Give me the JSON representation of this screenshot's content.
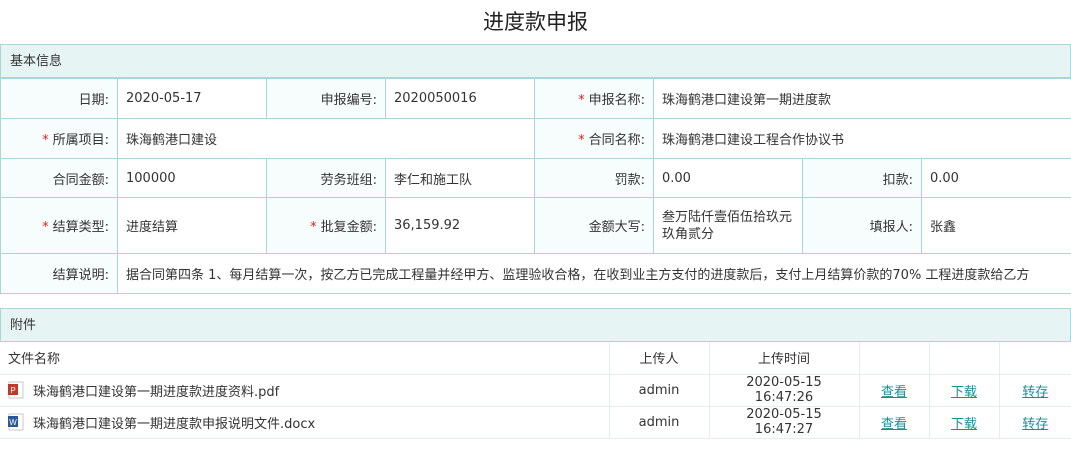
{
  "page": {
    "title": "进度款申报"
  },
  "basic": {
    "header": "基本信息",
    "rows": [
      [
        {
          "label": "日期:",
          "value": "2020-05-17",
          "required": false
        },
        {
          "label": "申报编号:",
          "value": "2020050016",
          "required": false
        },
        {
          "label": "申报名称:",
          "value": "珠海鹤港口建设第一期进度款",
          "required": true
        }
      ],
      [
        {
          "label": "所属项目:",
          "value": "珠海鹤港口建设",
          "required": true
        },
        {
          "label": "合同名称:",
          "value": "珠海鹤港口建设工程合作协议书",
          "required": true
        }
      ],
      [
        {
          "label": "合同金额:",
          "value": "100000",
          "required": false
        },
        {
          "label": "劳务班组:",
          "value": "李仁和施工队",
          "required": false
        },
        {
          "label": "罚款:",
          "value": "0.00",
          "required": false
        },
        {
          "label": "扣款:",
          "value": "0.00",
          "required": false
        }
      ],
      [
        {
          "label": "结算类型:",
          "value": "进度结算",
          "required": true
        },
        {
          "label": "批复金额:",
          "value": "36,159.92",
          "required": true
        },
        {
          "label": "金额大写:",
          "value": "叁万陆仟壹佰伍拾玖元玖角贰分",
          "required": false
        },
        {
          "label": "填报人:",
          "value": "张鑫",
          "required": false
        }
      ],
      [
        {
          "label": "结算说明:",
          "value": "据合同第四条 1、每月结算一次，按乙方已完成工程量并经甲方、监理验收合格，在收到业主方支付的进度款后，支付上月结算价款的70% 工程进度款给乙方",
          "required": false
        }
      ]
    ]
  },
  "attachments": {
    "header": "附件",
    "columns": {
      "name": "文件名称",
      "uploader": "上传人",
      "time": "上传时间"
    },
    "actions": {
      "view": "查看",
      "download": "下载",
      "transfer": "转存"
    },
    "files": [
      {
        "name": "珠海鹤港口建设第一期进度款进度资料.pdf",
        "uploader": "admin",
        "time": "2020-05-15 16:47:26",
        "icon": "pdf-file-icon"
      },
      {
        "name": "珠海鹤港口建设第一期进度款申报说明文件.docx",
        "uploader": "admin",
        "time": "2020-05-15 16:47:27",
        "icon": "word-file-icon"
      }
    ]
  },
  "colors": {
    "border": "#a9d6d6",
    "header_bg": "#e7f4f4",
    "required": "#e2231a",
    "link": "#1a8f8f"
  }
}
